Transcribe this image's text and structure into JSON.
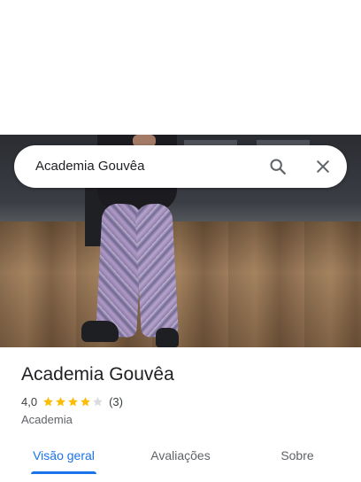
{
  "search": {
    "query": "Academia Gouvêa",
    "search_icon": "search-icon",
    "close_icon": "close-icon"
  },
  "hero_photo": {
    "icon": "place-photo"
  },
  "place": {
    "name": "Academia Gouvêa",
    "rating": "4,0",
    "rating_value": 4.0,
    "rating_max": 5,
    "review_count": "(3)",
    "category": "Academia"
  },
  "tabs": [
    {
      "label": "Visão geral",
      "selected": true
    },
    {
      "label": "Avaliações",
      "selected": false
    },
    {
      "label": "Sobre",
      "selected": false
    }
  ],
  "colors": {
    "accent": "#1a73e8",
    "star": "#fbbc04",
    "star_empty": "#dadce0",
    "text_primary": "#202124",
    "text_secondary": "#5f6368"
  }
}
